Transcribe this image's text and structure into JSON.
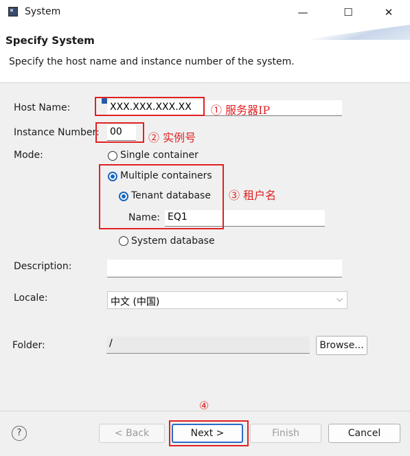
{
  "window": {
    "title": "System",
    "minimize": "—",
    "maximize": "☐",
    "close": "✕"
  },
  "header": {
    "heading": "Specify System",
    "description": "Specify the host name and instance number of the system."
  },
  "form": {
    "host_label": "Host Name:",
    "host_value": "XXX.XXX.XXX.XX",
    "instance_label": "Instance Number:",
    "instance_value": "00",
    "mode_label": "Mode:",
    "single_container": "Single container",
    "multiple_containers": "Multiple containers",
    "tenant_database": "Tenant database",
    "name_label": "Name:",
    "name_value": "EQ1",
    "system_database": "System database",
    "description_label": "Description:",
    "description_value": "",
    "locale_label": "Locale:",
    "locale_value": "中文 (中国)",
    "folder_label": "Folder:",
    "folder_value": "/",
    "browse_label": "Browse..."
  },
  "annotations": {
    "host_note": "① 服务器IP",
    "instance_note": "② 实例号",
    "tenant_note": "③ 租户名",
    "next_note": "④"
  },
  "footer": {
    "help_icon": "?",
    "back_label": "< Back",
    "next_label": "Next >",
    "finish_label": "Finish",
    "cancel_label": "Cancel"
  },
  "colors": {
    "annotation_red": "#e02020",
    "accent_blue": "#1565c0"
  }
}
